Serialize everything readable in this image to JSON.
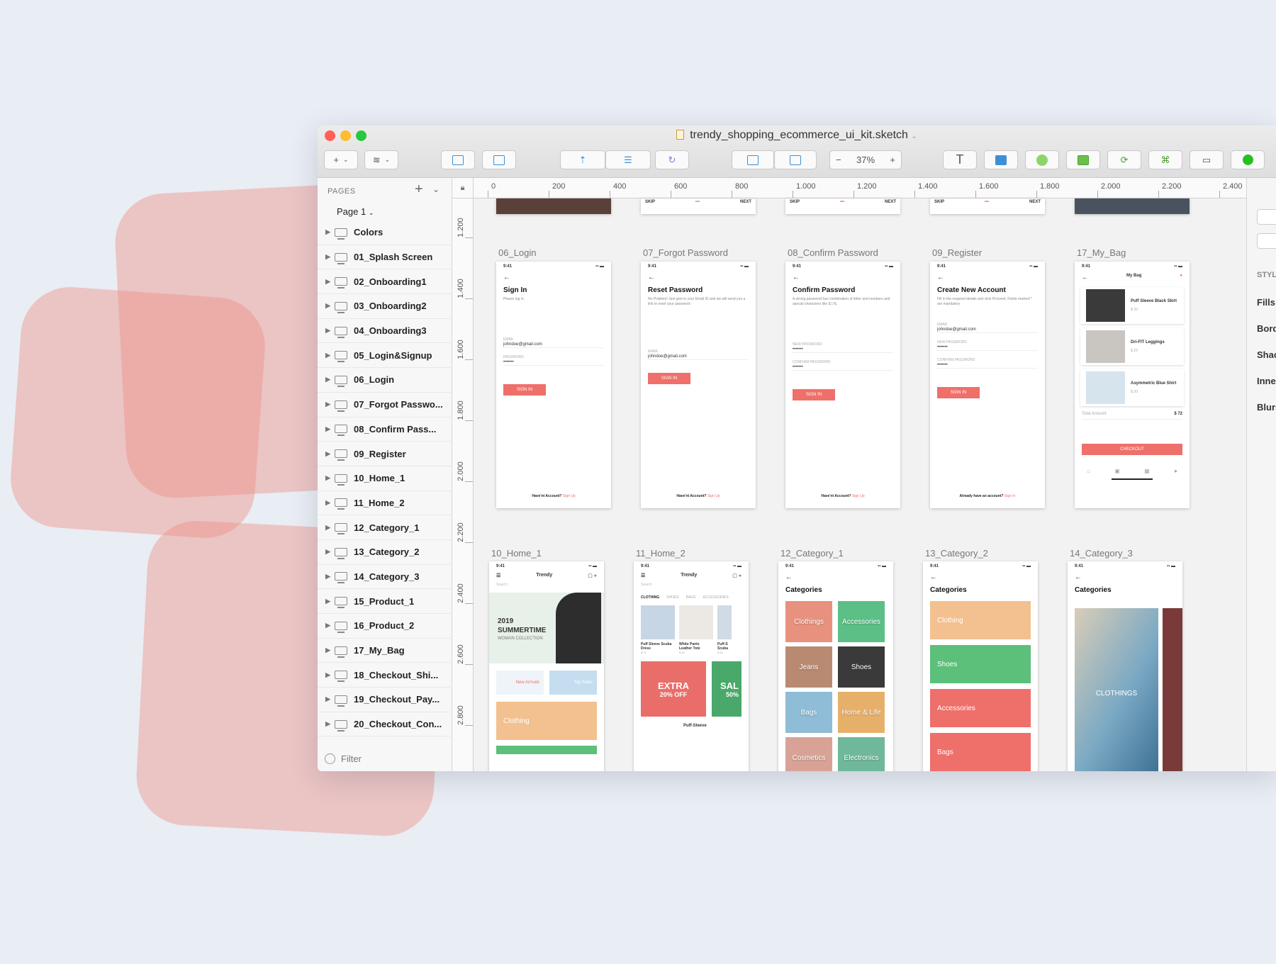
{
  "window": {
    "title": "trendy_shopping_ecommerce_ui_kit.sketch",
    "zoom": "37%"
  },
  "colors": {
    "accent": "#ef6f6a",
    "deco": "#ef8c80",
    "close": "#ff5f57",
    "minimize": "#febc2e",
    "maximize": "#28c840"
  },
  "sidebar": {
    "pages_heading": "PAGES",
    "current_page": "Page 1",
    "filter_placeholder": "Filter",
    "layers": [
      "Colors",
      "01_Splash Screen",
      "02_Onboarding1",
      "03_Onboarding2",
      "04_Onboarding3",
      "05_Login&Signup",
      "06_Login",
      "07_Forgot Passwo...",
      "08_Confirm Pass...",
      "09_Register",
      "10_Home_1",
      "11_Home_2",
      "12_Category_1",
      "13_Category_2",
      "14_Category_3",
      "15_Product_1",
      "16_Product_2",
      "17_My_Bag",
      "18_Checkout_Shi...",
      "19_Checkout_Pay...",
      "20_Checkout_Con..."
    ]
  },
  "ruler": {
    "top": [
      "0",
      "200",
      "400",
      "600",
      "800",
      "1.000",
      "1.200",
      "1.400",
      "1.600",
      "1.800",
      "2.000",
      "2.200",
      "2.400"
    ],
    "left": [
      "1.200",
      "1.400",
      "1.600",
      "1.800",
      "2.000",
      "2.200",
      "2.400",
      "2.600",
      "2.800"
    ]
  },
  "inspector": [
    "STYL",
    "Fills",
    "Bord",
    "Shac",
    "Inner",
    "Blurs"
  ],
  "onboard": {
    "skip": "SKIP",
    "next": "NEXT"
  },
  "artboards": {
    "login": {
      "label": "06_Login",
      "time": "9:41",
      "title": "Sign In",
      "desc": "Please log in.",
      "email_label": "EMAIL",
      "email": "johndoe@gmail.com",
      "pw_label": "PASSWORD",
      "pw": "•••••••",
      "button": "SIGN IN",
      "foot": "Have'nt Account?",
      "foot_link": "Sign Up"
    },
    "forgot": {
      "label": "07_Forgot Password",
      "time": "9:41",
      "title": "Reset Password",
      "desc": "No Problem! Just give in your Email ID and we will send you a link to reset your password",
      "email_label": "EMAIL",
      "email": "johndoe@gmail.com",
      "button": "SIGN IN",
      "foot": "Have'nt Account?",
      "foot_link": "Sign Up"
    },
    "confirm": {
      "label": "08_Confirm Password",
      "time": "9:41",
      "title": "Confirm Password",
      "desc": "A strong password has combination of letter and numbers and special characters like $,!,%,",
      "new_label": "NEW PASSWORD",
      "new": "•••••••",
      "conf_label": "CONFIRM PASSWORD",
      "conf": "•••••••",
      "button": "SIGN IN",
      "foot": "Have'nt Account?",
      "foot_link": "Sign Up"
    },
    "register": {
      "label": "09_Register",
      "time": "9:41",
      "title": "Create New Account",
      "desc": "Fill in the required details and click Proceed. Fields marked * are mandatory",
      "email_label": "EMAIL",
      "email": "johndoe@gmail.com",
      "new_label": "NEW PASSWORD",
      "new": "•••••••",
      "conf_label": "CONFIRM PASSWORD",
      "conf": "•••••••",
      "button": "SIGN IN",
      "foot": "Already have an account?",
      "foot_link": "Sign In"
    },
    "bag": {
      "label": "17_My_Bag",
      "time": "9:41",
      "title": "My Bag",
      "items": [
        {
          "name": "Puff Sleeve Black Skirt",
          "price": "$ 20"
        },
        {
          "name": "Dri-FIT Leggings",
          "price": "$ 22"
        },
        {
          "name": "Asymmetric Blue Shirt",
          "price": "$ 30"
        }
      ],
      "total_label": "Total Amount",
      "total": "$ 72",
      "button": "CHECKOUT"
    },
    "home1": {
      "label": "10_Home_1",
      "time": "9:41",
      "brand": "Trendy",
      "search": "Search",
      "year": "2019",
      "headline": "SUMMERTIME",
      "sub": "WOMAN COLLECTION",
      "tile1": "New Arrivals",
      "tile2": "Top Sales",
      "cat": "Clothing"
    },
    "home2": {
      "label": "11_Home_2",
      "time": "9:41",
      "brand": "Trendy",
      "search": "Search",
      "tabs": [
        "CLOTHING",
        "SHOES",
        "BAGS",
        "ACCESSORIES"
      ],
      "products": [
        {
          "name": "Puff Sleeve Scuba Dress",
          "price": "$ 70"
        },
        {
          "name": "White Pants Leather Tote",
          "price": "$ 40"
        },
        {
          "name": "Puff-S Scuba",
          "price": "$ 30"
        }
      ],
      "promo1": "EXTRA",
      "promo1_sub": "20% OFF",
      "promo2": "SAL",
      "promo2_sub": "50%",
      "bottom": "Puff-Sleeve"
    },
    "cat1": {
      "label": "12_Category_1",
      "time": "9:41",
      "title": "Categories",
      "tiles": [
        "Clothings",
        "Accessories",
        "Jeans",
        "Shoes",
        "Bags",
        "Home & Life",
        "Cosmetics",
        "Electronics"
      ]
    },
    "cat2": {
      "label": "13_Category_2",
      "time": "9:41",
      "title": "Categories",
      "rows": [
        "Clothing",
        "Shoes",
        "Accessories",
        "Bags"
      ]
    },
    "cat3": {
      "label": "14_Category_3",
      "time": "9:41",
      "title": "Categories",
      "tile": "CLOTHINGS"
    }
  }
}
